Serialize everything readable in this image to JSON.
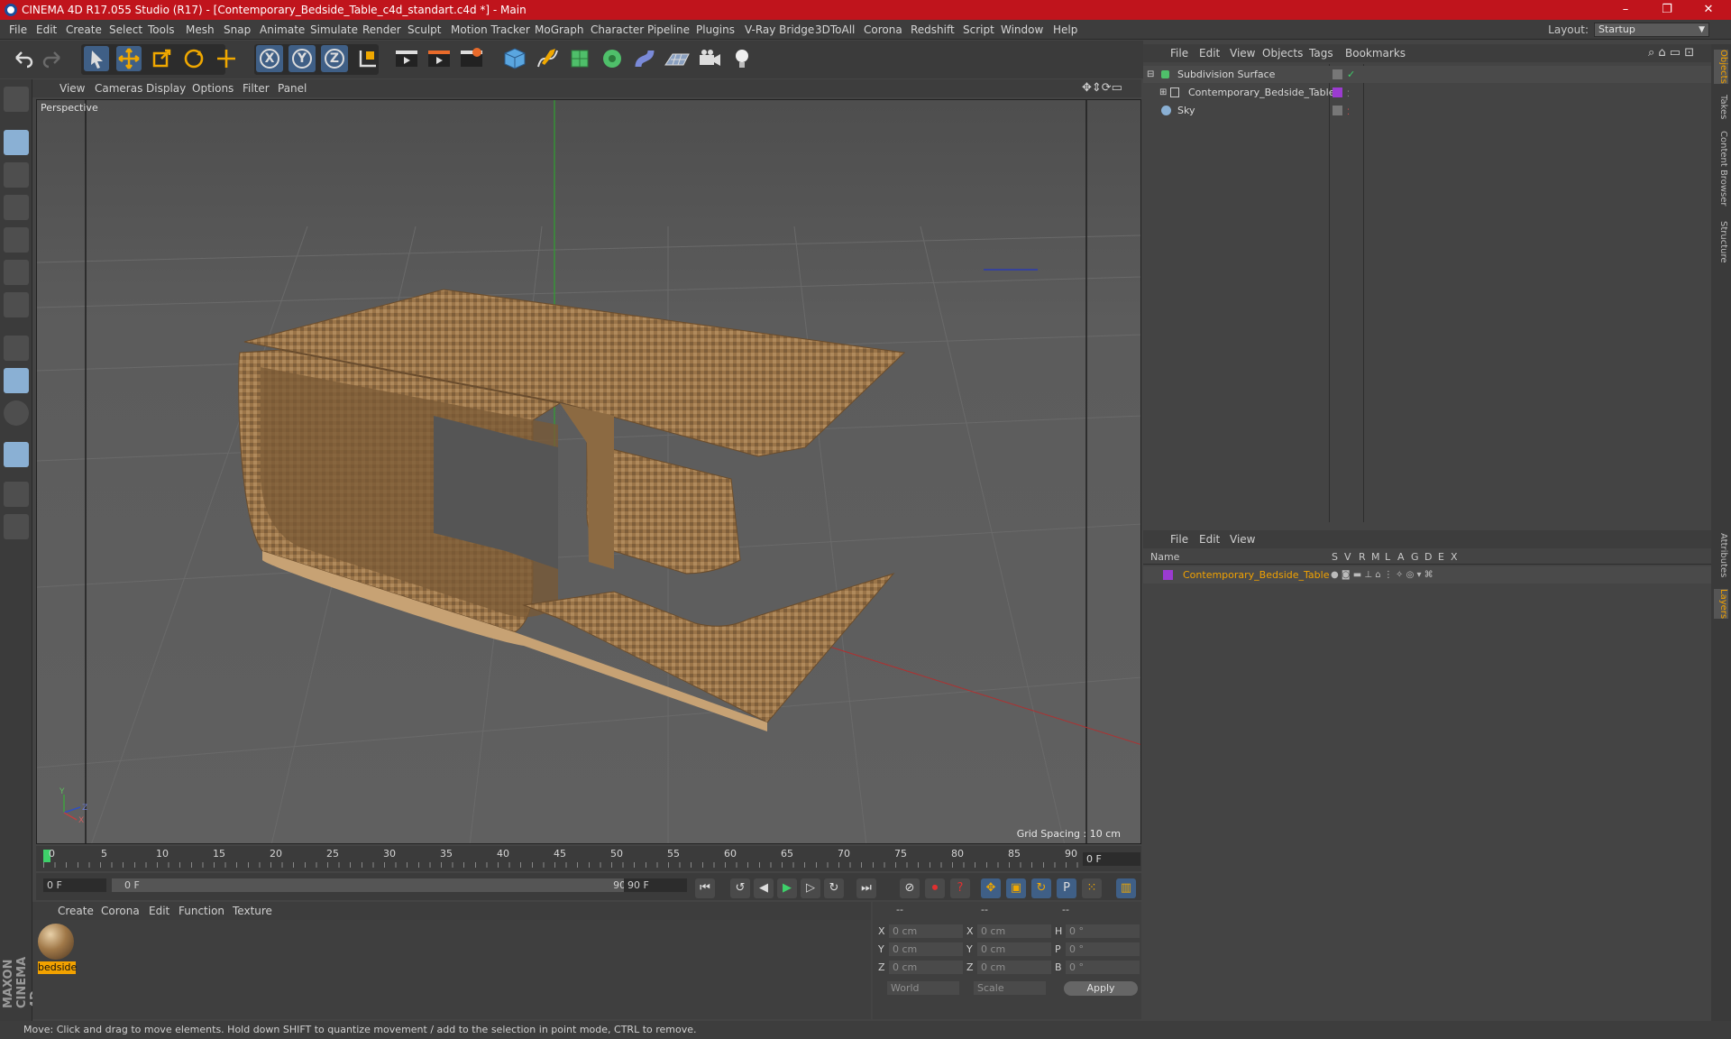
{
  "window": {
    "title": "CINEMA 4D R17.055 Studio (R17) - [Contemporary_Bedside_Table_c4d_standart.c4d *] - Main",
    "minimize": "–",
    "maximize": "❐",
    "close": "✕"
  },
  "menubar": {
    "items": [
      "File",
      "Edit",
      "Create",
      "Select",
      "Tools",
      "Mesh",
      "Snap",
      "Animate",
      "Simulate",
      "Render",
      "Sculpt",
      "Motion Tracker",
      "MoGraph",
      "Character",
      "Pipeline",
      "Plugins",
      "V-Ray Bridge",
      "3DToAll",
      "Corona",
      "Redshift",
      "Script",
      "Window",
      "Help"
    ],
    "layout_label": "Layout:",
    "layout_value": "Startup"
  },
  "toolbar": {
    "axis_x": "X",
    "axis_y": "Y",
    "axis_z": "Z"
  },
  "viewport": {
    "menu": [
      "View",
      "Cameras",
      "Display",
      "Options",
      "Filter",
      "Panel"
    ],
    "camera_label": "Perspective",
    "grid_spacing": "Grid Spacing : 10 cm",
    "axis_labels": {
      "y": "Y",
      "z": "Z",
      "x": "X"
    }
  },
  "timeline": {
    "ticks": [
      "0",
      "5",
      "10",
      "15",
      "20",
      "25",
      "30",
      "35",
      "40",
      "45",
      "50",
      "55",
      "60",
      "65",
      "70",
      "75",
      "80",
      "85",
      "90"
    ],
    "current_frame": "0 F"
  },
  "transport": {
    "start_field": "0 F",
    "range_start": "0 F",
    "range_end": "90 F",
    "end_field": "90 F"
  },
  "material_manager": {
    "menu": [
      "Create",
      "Corona",
      "Edit",
      "Function",
      "Texture"
    ],
    "materials": [
      {
        "name": "bedside"
      }
    ]
  },
  "coordinates": {
    "headers": [
      "--",
      "--",
      "--"
    ],
    "rows": [
      {
        "l1": "X",
        "v1": "0 cm",
        "l2": "X",
        "v2": "0 cm",
        "l3": "H",
        "v3": "0 °"
      },
      {
        "l1": "Y",
        "v1": "0 cm",
        "l2": "Y",
        "v2": "0 cm",
        "l3": "P",
        "v3": "0 °"
      },
      {
        "l1": "Z",
        "v1": "0 cm",
        "l2": "Z",
        "v2": "0 cm",
        "l3": "B",
        "v3": "0 °"
      }
    ],
    "world_select": "World",
    "scale_select": "Scale",
    "apply_label": "Apply"
  },
  "status": {
    "text": "Move: Click and drag to move elements. Hold down SHIFT to quantize movement / add to the selection in point mode, CTRL to remove."
  },
  "object_manager": {
    "menu": [
      "File",
      "Edit",
      "View",
      "Objects",
      "Tags",
      "Bookmarks"
    ],
    "objects": [
      {
        "name": "Subdivision Surface"
      },
      {
        "name": "Contemporary_Bedside_Table"
      },
      {
        "name": "Sky"
      }
    ]
  },
  "layer_manager": {
    "menu": [
      "File",
      "Edit",
      "View"
    ],
    "columns": [
      "Name",
      "S",
      "V",
      "R",
      "M",
      "L",
      "A",
      "G",
      "D",
      "E",
      "X"
    ],
    "layers": [
      {
        "name": "Contemporary_Bedside_Table",
        "color": "#9b3bd0"
      }
    ]
  },
  "right_tabs": [
    "Objects",
    "Takes",
    "Content Browser",
    "Structure",
    "Attributes",
    "Layers"
  ],
  "branding": {
    "logo": "MAXON CINEMA 4D"
  },
  "colors": {
    "accent_red": "#c0141c",
    "selection_orange": "#f2a200",
    "layer_purple": "#9b3bd0"
  }
}
